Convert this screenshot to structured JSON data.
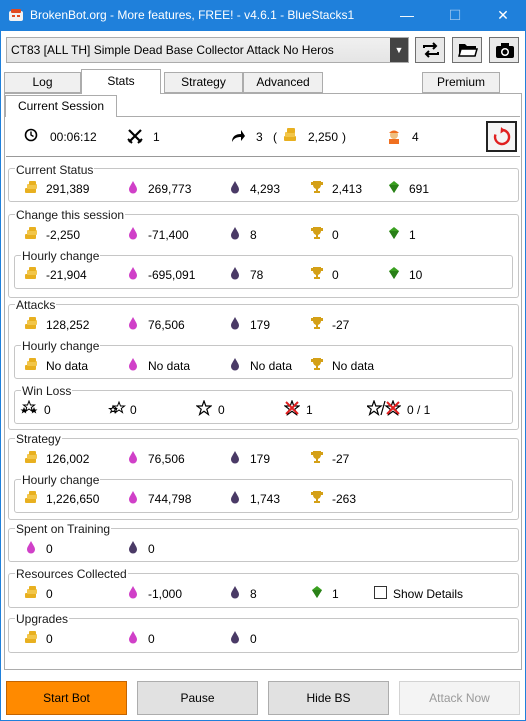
{
  "window": {
    "title": "BrokenBot.org - More features, FREE! - v4.6.1 - BlueStacks1"
  },
  "profile": {
    "selected": "CT83 [ALL TH] Simple Dead Base Collector Attack No Heros"
  },
  "tabs": [
    "Log",
    "Stats",
    "Strategy",
    "Advanced",
    "Premium"
  ],
  "subtab": "Current Session",
  "summary": {
    "time": "00:06:12",
    "attacks": "1",
    "skips": "3",
    "skip_open": "(",
    "skip_cost": "2,250",
    "skip_close": ")",
    "lab": "4"
  },
  "current_status": {
    "label": "Current Status",
    "gold": "291,389",
    "elixir": "269,773",
    "dark": "4,293",
    "trophy": "2,413",
    "gem": "691"
  },
  "change_session": {
    "label": "Change this session",
    "gold": "-2,250",
    "elixir": "-71,400",
    "dark": "8",
    "trophy": "0",
    "gem": "1"
  },
  "change_hourly": {
    "label": "Hourly change",
    "gold": "-21,904",
    "elixir": "-695,091",
    "dark": "78",
    "trophy": "0",
    "gem": "10"
  },
  "attacks": {
    "label": "Attacks",
    "gold": "128,252",
    "elixir": "76,506",
    "dark": "179",
    "trophy": "-27"
  },
  "attacks_hourly": {
    "label": "Hourly change",
    "gold": "No data",
    "elixir": "No data",
    "dark": "No data",
    "trophy": "No data"
  },
  "winloss": {
    "label": "Win Loss",
    "three_star": "0",
    "two_star": "0",
    "one_star": "0",
    "zero_star": "1",
    "ratio": "0 / 1"
  },
  "strategy": {
    "label": "Strategy",
    "gold": "126,002",
    "elixir": "76,506",
    "dark": "179",
    "trophy": "-27"
  },
  "strategy_hourly": {
    "label": "Hourly change",
    "gold": "1,226,650",
    "elixir": "744,798",
    "dark": "1,743",
    "trophy": "-263"
  },
  "training": {
    "label": "Spent on Training",
    "elixir": "0",
    "dark": "0"
  },
  "collected": {
    "label": "Resources Collected",
    "gold": "0",
    "elixir": "-1,000",
    "dark": "8",
    "gem": "1",
    "show_details": "Show Details"
  },
  "upgrades": {
    "label": "Upgrades",
    "gold": "0",
    "elixir": "0",
    "dark": "0"
  },
  "buttons": {
    "start": "Start Bot",
    "pause": "Pause",
    "hide": "Hide BS",
    "attack": "Attack Now"
  },
  "colors": {
    "titlebar": "#1f80db",
    "gold": "#e8b020",
    "elixir": "#d040c8",
    "dark": "#4a3a66",
    "trophy": "#d4a017",
    "gem": "#3aa020",
    "start": "#ff8a00",
    "reset": "#e02020"
  },
  "icons": {
    "clock": "clock-icon",
    "swords": "crossed-swords-icon",
    "skip": "skip-arrow-icon",
    "coins": "gold-coins-icon",
    "elixir": "elixir-drop-icon",
    "dark": "dark-elixir-drop-icon",
    "trophy": "trophy-icon",
    "gem": "gem-icon",
    "builder": "builder-icon",
    "reset": "reset-icon"
  }
}
